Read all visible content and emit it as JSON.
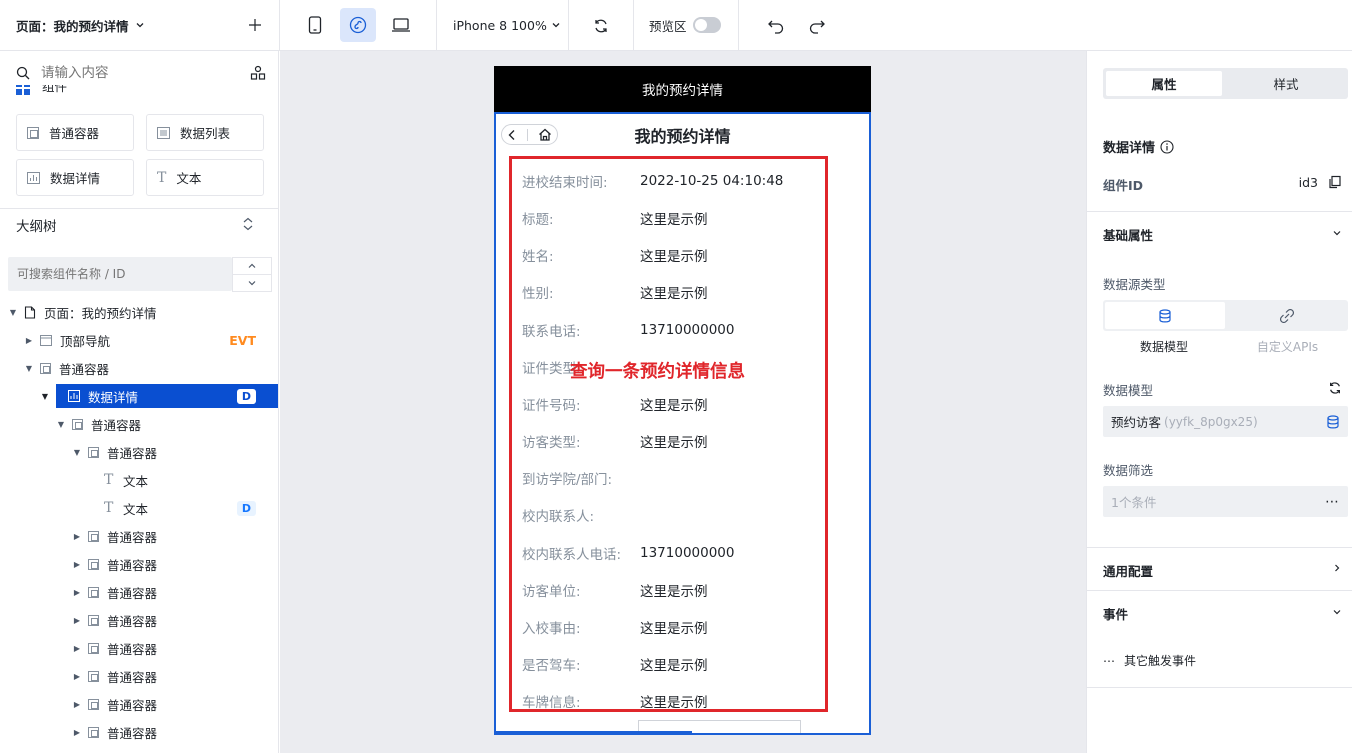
{
  "topbar": {
    "page_title": "页面：我的预约详情",
    "device_label": "iPhone 8 100%",
    "preview_label": "预览区"
  },
  "left": {
    "search_placeholder": "请输入内容",
    "partial_group_label": "组件",
    "components": [
      {
        "label": "普通容器",
        "icon": "container-icon"
      },
      {
        "label": "数据列表",
        "icon": "list-icon"
      },
      {
        "label": "数据详情",
        "icon": "chart-icon"
      },
      {
        "label": "文本",
        "icon": "text-icon"
      }
    ],
    "outline_title": "大纲树",
    "outline_search_placeholder": "可搜索组件名称 / ID",
    "tree": [
      {
        "label": "页面：我的预约详情",
        "level": 0,
        "caret": "▼",
        "icon": "page-icon",
        "badge": ""
      },
      {
        "label": "顶部导航",
        "level": 1,
        "caret": "▶",
        "icon": "nav-icon",
        "badge": "EVT"
      },
      {
        "label": "普通容器",
        "level": 1,
        "caret": "▼",
        "icon": "container-icon",
        "badge": ""
      },
      {
        "label": "数据详情",
        "level": 2,
        "caret": "▼",
        "icon": "chart-icon",
        "badge": "D",
        "selected": true
      },
      {
        "label": "普通容器",
        "level": 3,
        "caret": "▼",
        "icon": "container-icon",
        "badge": ""
      },
      {
        "label": "普通容器",
        "level": 4,
        "caret": "▼",
        "icon": "container-icon",
        "badge": ""
      },
      {
        "label": "文本",
        "level": 5,
        "caret": "",
        "icon": "text-icon",
        "badge": ""
      },
      {
        "label": "文本",
        "level": 5,
        "caret": "",
        "icon": "text-icon",
        "badge": "D"
      },
      {
        "label": "普通容器",
        "level": 4,
        "caret": "▶",
        "icon": "container-icon",
        "badge": ""
      },
      {
        "label": "普通容器",
        "level": 4,
        "caret": "▶",
        "icon": "container-icon",
        "badge": ""
      },
      {
        "label": "普通容器",
        "level": 4,
        "caret": "▶",
        "icon": "container-icon",
        "badge": ""
      },
      {
        "label": "普通容器",
        "level": 4,
        "caret": "▶",
        "icon": "container-icon",
        "badge": ""
      },
      {
        "label": "普通容器",
        "level": 4,
        "caret": "▶",
        "icon": "container-icon",
        "badge": ""
      },
      {
        "label": "普通容器",
        "level": 4,
        "caret": "▶",
        "icon": "container-icon",
        "badge": ""
      },
      {
        "label": "普通容器",
        "level": 4,
        "caret": "▶",
        "icon": "container-icon",
        "badge": ""
      },
      {
        "label": "普通容器",
        "level": 4,
        "caret": "▶",
        "icon": "container-icon",
        "badge": ""
      }
    ]
  },
  "phone": {
    "header_title": "我的预约详情",
    "page_title": "我的预约详情",
    "annotation": "查询一条预约详情信息",
    "fields": [
      {
        "label": "进校结束时间:",
        "value": "2022-10-25 04:10:48"
      },
      {
        "label": "标题:",
        "value": "这里是示例"
      },
      {
        "label": "姓名:",
        "value": "这里是示例"
      },
      {
        "label": "性别:",
        "value": "这里是示例"
      },
      {
        "label": "联系电话:",
        "value": "13710000000"
      },
      {
        "label": "证件类型:",
        "value": ""
      },
      {
        "label": "证件号码:",
        "value": "这里是示例"
      },
      {
        "label": "访客类型:",
        "value": "这里是示例"
      },
      {
        "label": "到访学院/部门:",
        "value": ""
      },
      {
        "label": "校内联系人:",
        "value": ""
      },
      {
        "label": "校内联系人电话:",
        "value": "13710000000"
      },
      {
        "label": "访客单位:",
        "value": "这里是示例"
      },
      {
        "label": "入校事由:",
        "value": "这里是示例"
      },
      {
        "label": "是否驾车:",
        "value": "这里是示例"
      },
      {
        "label": "车牌信息:",
        "value": "这里是示例"
      }
    ]
  },
  "right": {
    "tab_props": "属性",
    "tab_style": "样式",
    "component_title": "数据详情",
    "component_id_label": "组件ID",
    "component_id_value": "id3",
    "basic_section": "基础属性",
    "datasource_type_label": "数据源类型",
    "datasource_option_model": "数据模型",
    "datasource_option_api": "自定义APIs",
    "data_model_label": "数据模型",
    "data_model_name": "预约访客",
    "data_model_id": "(yyfk_8p0gx25)",
    "filter_label": "数据筛选",
    "filter_value": "1个条件",
    "general_section": "通用配置",
    "events_section": "事件",
    "other_events": "其它触发事件"
  },
  "colors": {
    "accent": "#1a5fd6",
    "selected_row": "#0a4fd1",
    "annotation_red": "#e0262b",
    "evt_orange": "#ff8a1f"
  }
}
